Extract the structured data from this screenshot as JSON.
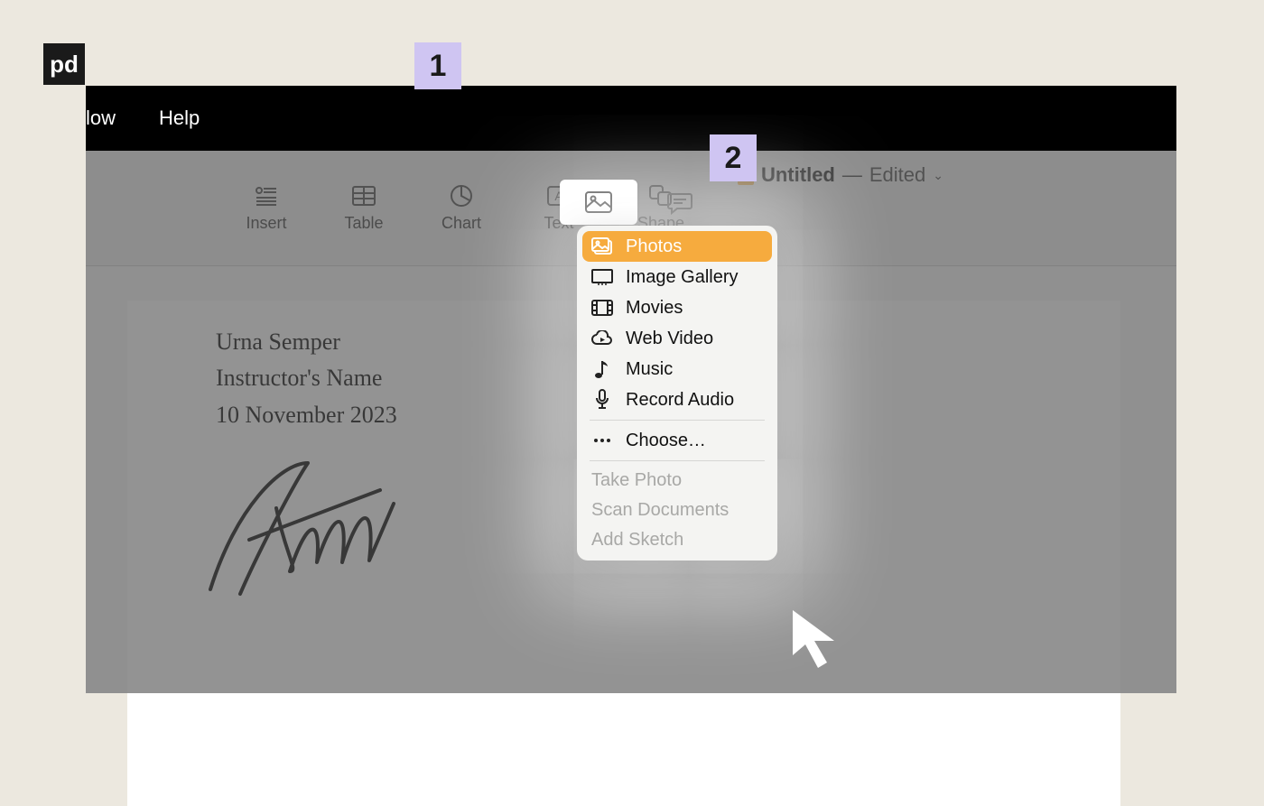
{
  "logo": {
    "text": "pd"
  },
  "menubar": {
    "items": [
      "low",
      "Help"
    ]
  },
  "toolbar": {
    "items": [
      {
        "label": "Insert"
      },
      {
        "label": "Table"
      },
      {
        "label": "Chart"
      },
      {
        "label": "Text"
      },
      {
        "label": "Shape"
      }
    ]
  },
  "document_title": {
    "name": "Untitled",
    "separator": "—",
    "status": "Edited"
  },
  "callouts": {
    "one": "1",
    "two": "2"
  },
  "dropdown": {
    "photos": "Photos",
    "image_gallery": "Image Gallery",
    "movies": "Movies",
    "web_video": "Web Video",
    "music": "Music",
    "record_audio": "Record Audio",
    "choose": "Choose…",
    "take_photo": "Take Photo",
    "scan_documents": "Scan Documents",
    "add_sketch": "Add Sketch"
  },
  "document_body": {
    "line1": "Urna Semper",
    "line2": "Instructor's Name",
    "line3": "10 November 2023"
  }
}
